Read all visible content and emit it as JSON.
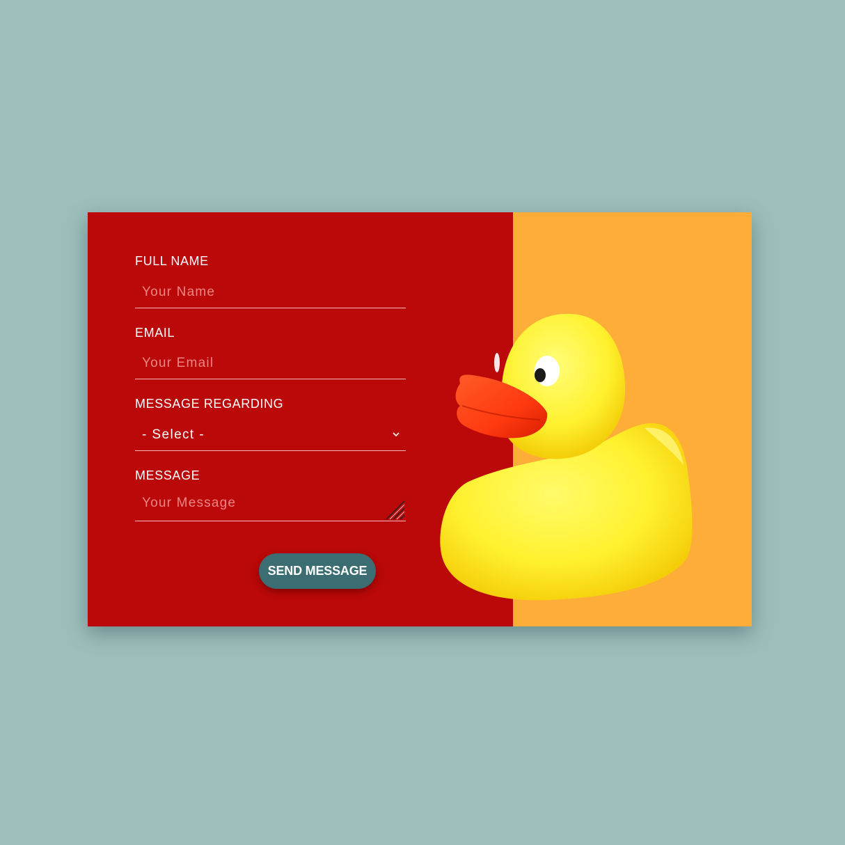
{
  "form": {
    "full_name": {
      "label": "FULL NAME",
      "placeholder": "Your Name"
    },
    "email": {
      "label": "EMAIL",
      "placeholder": "Your Email"
    },
    "regarding": {
      "label": "MESSAGE REGARDING",
      "selected": "- Select -"
    },
    "message": {
      "label": "MESSAGE",
      "placeholder": "Your Message"
    },
    "submit_label": "SEND MESSAGE"
  },
  "colors": {
    "page_background": "#9dbfbc",
    "form_panel": "#bb0808",
    "image_panel": "#ffad39",
    "button": "#3b6d72",
    "duck_body": "#fff12e",
    "duck_beak": "#ff3a10"
  },
  "image": {
    "subject": "rubber-duck"
  }
}
